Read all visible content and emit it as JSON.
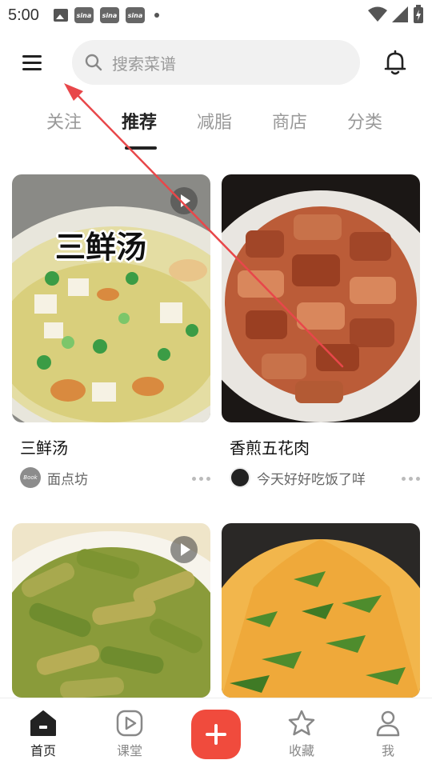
{
  "status_bar": {
    "time": "5:00",
    "notif_app_label": "sina"
  },
  "header": {
    "search_placeholder": "搜索菜谱"
  },
  "tabs": [
    {
      "label": "关注",
      "active": false
    },
    {
      "label": "推荐",
      "active": true
    },
    {
      "label": "减脂",
      "active": false
    },
    {
      "label": "商店",
      "active": false
    },
    {
      "label": "分类",
      "active": false
    }
  ],
  "feed": {
    "cards": [
      {
        "title": "三鲜汤",
        "overlay_text": "三鲜汤",
        "author": "面点坊",
        "avatar_text": "Book",
        "has_video": true
      },
      {
        "title": "香煎五花肉",
        "author": "今天好好吃饭了咩",
        "has_video": false
      },
      {
        "has_video": true
      },
      {
        "has_video": false
      }
    ]
  },
  "bottom_nav": [
    {
      "label": "首页",
      "icon": "home-icon",
      "active": true
    },
    {
      "label": "课堂",
      "icon": "play-square-icon",
      "active": false
    },
    {
      "label": "",
      "icon": "plus-icon",
      "active": false
    },
    {
      "label": "收藏",
      "icon": "star-icon",
      "active": false
    },
    {
      "label": "我",
      "icon": "user-icon",
      "active": false
    }
  ],
  "colors": {
    "accent": "#f04b3d",
    "annotation": "#e8474a",
    "tab_active": "#222222",
    "tab_inactive": "#999999"
  }
}
